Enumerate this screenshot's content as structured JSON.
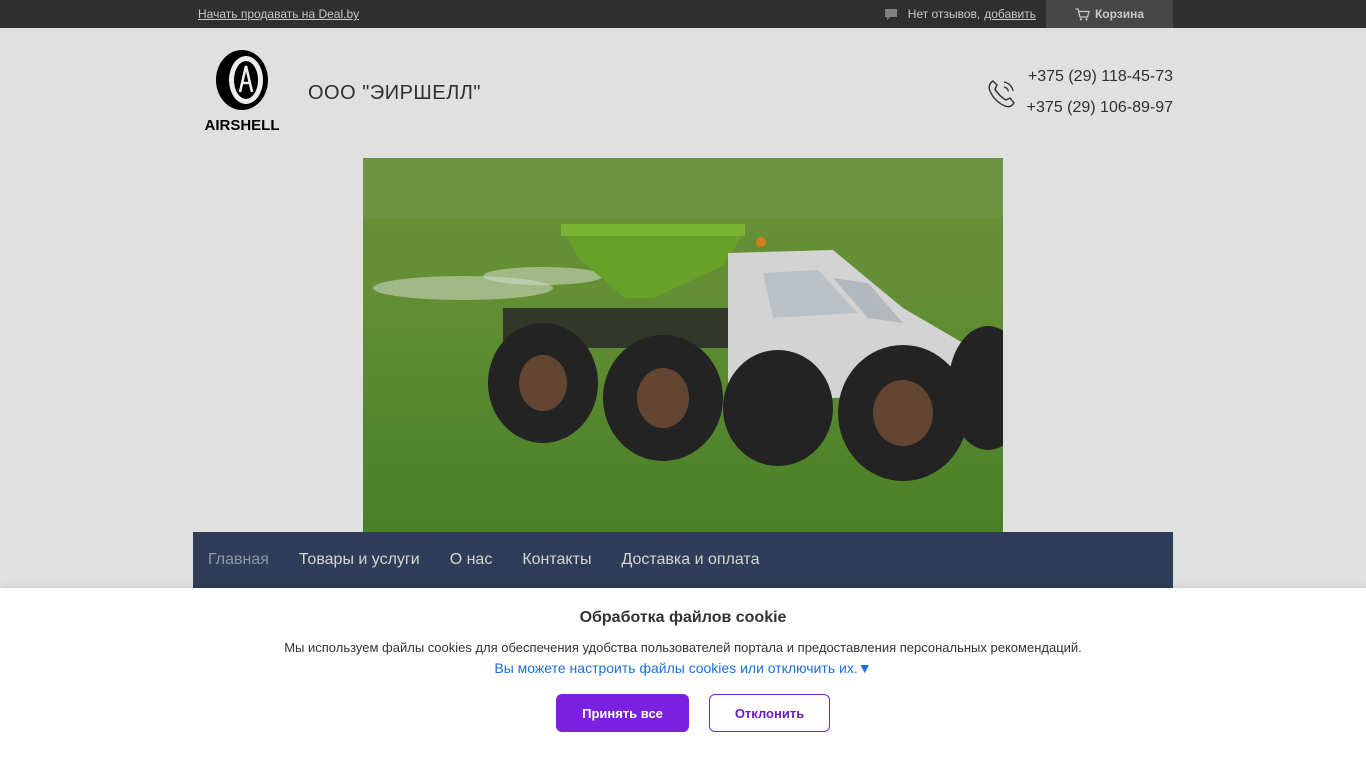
{
  "topbar": {
    "sell_link": "Начать продавать на Deal.by",
    "reviews_text": "Нет отзывов,",
    "reviews_add": "добавить",
    "cart_label": "Корзина"
  },
  "header": {
    "logo_text": "AIRSHELL",
    "company_name": "ООО \"ЭИРШЕЛЛ\"",
    "phones": [
      "+375 (29) 118-45-73",
      "+375 (29) 106-89-97"
    ]
  },
  "nav": {
    "items": [
      "Главная",
      "Товары и услуги",
      "О нас",
      "Контакты",
      "Доставка и оплата"
    ]
  },
  "cookie": {
    "title": "Обработка файлов cookie",
    "text": "Мы используем файлы cookies для обеспечения удобства пользователей портала и предоставления персональных рекомендаций.",
    "settings_link": "Вы можете настроить файлы cookies или отключить их.▼",
    "accept_label": "Принять все",
    "decline_label": "Отклонить"
  },
  "colors": {
    "topbar": "#333333",
    "nav": "#33425f",
    "accent": "#7b1fe0",
    "link": "#1a6fdd"
  }
}
